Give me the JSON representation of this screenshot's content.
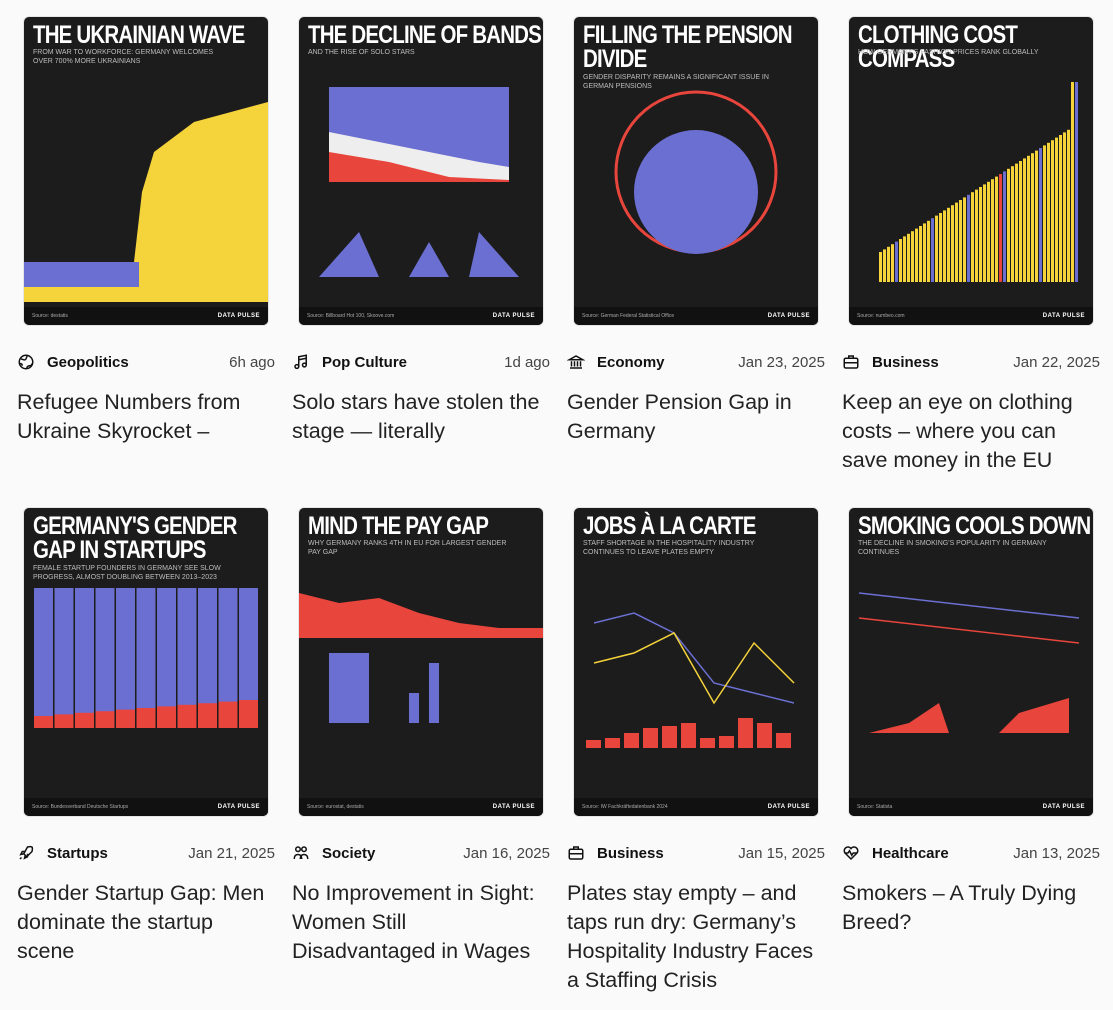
{
  "brand_logo": "DATA PULSE",
  "colors": {
    "background": "#fafafa",
    "thumb_bg": "#1c1c1c",
    "yellow": "#f5d33b",
    "blue": "#6b6fd1",
    "red": "#e8453c"
  },
  "articles": [
    {
      "category": "Geopolitics",
      "icon": "globe-icon",
      "date": "6h ago",
      "title": "Refugee Numbers from Ukraine Skyrocket –",
      "thumb": {
        "title": "The Ukrainian Wave",
        "subtitle": "From war to workforce: Germany welcomes over 700% more Ukrainians",
        "source": "Source: destatis",
        "viz": "area-yellow"
      }
    },
    {
      "category": "Pop Culture",
      "icon": "music-note-icon",
      "date": "1d ago",
      "title": "Solo stars have stolen the stage — literally",
      "thumb": {
        "title": "The Decline of Bands",
        "subtitle": "And the rise of solo stars",
        "source": "Source: Billboard Hot 100, Skoove.com",
        "viz": "area-stack"
      }
    },
    {
      "category": "Economy",
      "icon": "bank-icon",
      "date": "Jan 23, 2025",
      "title": "Gender Pension Gap in Germany",
      "thumb": {
        "title": "Filling the Pension Divide",
        "subtitle": "Gender disparity remains a significant issue in German pensions",
        "source": "Source: German Federal Statistical Office",
        "viz": "circle"
      }
    },
    {
      "category": "Business",
      "icon": "briefcase-icon",
      "date": "Jan 22, 2025",
      "title": "Keep an eye on clothing costs – where you can save money in the EU",
      "thumb": {
        "title": "Clothing Cost Compass",
        "subtitle": "How Germany's fashion prices rank globally",
        "source": "Source: numbeo.com",
        "viz": "bars-yellow"
      }
    },
    {
      "category": "Startups",
      "icon": "rocket-icon",
      "date": "Jan 21, 2025",
      "title": "Gender Startup Gap: Men dominate the startup scene",
      "thumb": {
        "title": "Germany's Gender Gap in Startups",
        "subtitle": "Female startup founders in Germany see slow progress, almost doubling between 2013–2023",
        "source": "Source: Bundesverband Deutsche Startups",
        "viz": "bars-stack"
      }
    },
    {
      "category": "Society",
      "icon": "people-icon",
      "date": "Jan 16, 2025",
      "title": "No Improvement in Sight: Women Still Disadvantaged in Wages",
      "thumb": {
        "title": "Mind the Pay Gap",
        "subtitle": "Why Germany ranks 4th in EU for largest gender pay gap",
        "source": "Source: eurostat, destatis",
        "viz": "area-red"
      }
    },
    {
      "category": "Business",
      "icon": "briefcase-icon",
      "date": "Jan 15, 2025",
      "title": "Plates stay empty – and taps run dry: Germany’s Hospitality Industry Faces a Staffing Crisis",
      "thumb": {
        "title": "Jobs à la Carte",
        "subtitle": "Staff shortage in the hospitality industry continues to leave plates empty",
        "source": "Source: IW Fachkräftedatenbank 2024",
        "viz": "lines-bars"
      }
    },
    {
      "category": "Healthcare",
      "icon": "heart-pulse-icon",
      "date": "Jan 13, 2025",
      "title": "Smokers – A Truly Dying Breed?",
      "thumb": {
        "title": "Smoking Cools Down",
        "subtitle": "The decline in smoking's popularity in Germany continues",
        "source": "Source: Statista",
        "viz": "lines"
      }
    }
  ]
}
